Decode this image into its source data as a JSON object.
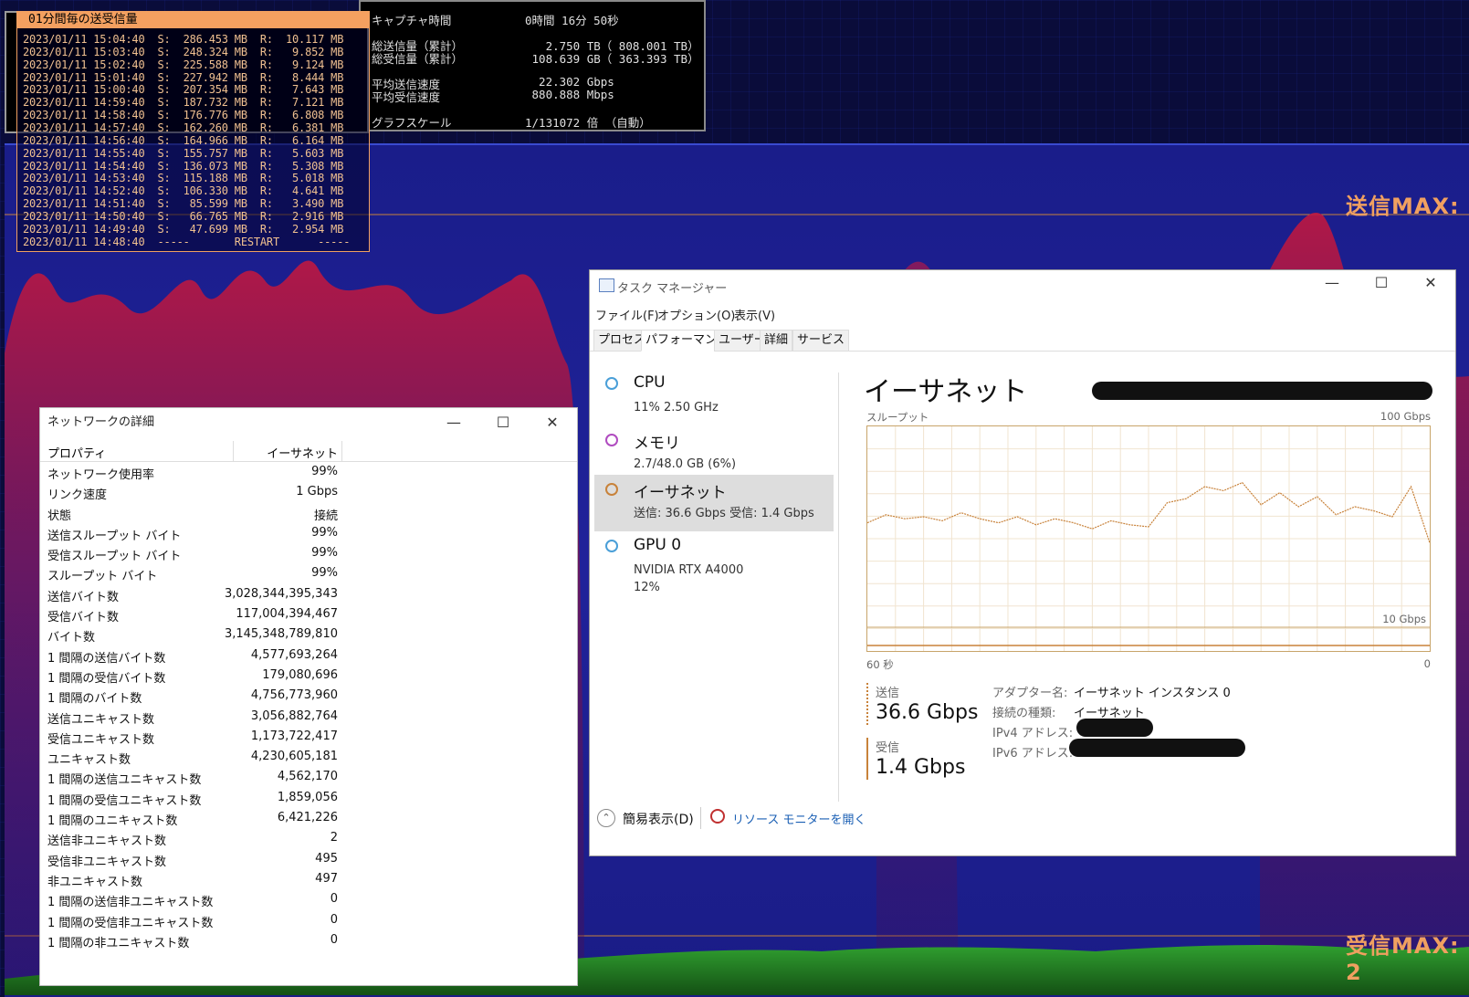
{
  "monitor": {
    "log_header": "01分間毎の送受信量",
    "log_rows": [
      "2023/01/11 15:04:40  S:  286.453 MB  R:  10.117 MB",
      "2023/01/11 15:03:40  S:  248.324 MB  R:   9.852 MB",
      "2023/01/11 15:02:40  S:  225.588 MB  R:   9.124 MB",
      "2023/01/11 15:01:40  S:  227.942 MB  R:   8.444 MB",
      "2023/01/11 15:00:40  S:  207.354 MB  R:   7.643 MB",
      "2023/01/11 14:59:40  S:  187.732 MB  R:   7.121 MB",
      "2023/01/11 14:58:40  S:  176.776 MB  R:   6.808 MB",
      "2023/01/11 14:57:40  S:  162.260 MB  R:   6.381 MB",
      "2023/01/11 14:56:40  S:  164.966 MB  R:   6.164 MB",
      "2023/01/11 14:55:40  S:  155.757 MB  R:   5.603 MB",
      "2023/01/11 14:54:40  S:  136.073 MB  R:   5.308 MB",
      "2023/01/11 14:53:40  S:  115.188 MB  R:   5.018 MB",
      "2023/01/11 14:52:40  S:  106.330 MB  R:   4.641 MB",
      "2023/01/11 14:51:40  S:   85.599 MB  R:   3.490 MB",
      "2023/01/11 14:50:40  S:   66.765 MB  R:   2.916 MB",
      "2023/01/11 14:49:40  S:   47.699 MB  R:   2.954 MB",
      "2023/01/11 14:48:40  -----       RESTART      -----"
    ],
    "summary": [
      {
        "label": "キャプチャ時間",
        "value": "0時間 16分 50秒"
      },
      {
        "label": "総送信量（累計）",
        "value": "   2.750 TB（ 808.001 TB）"
      },
      {
        "label": "総受信量（累計）",
        "value": " 108.639 GB（ 363.393 TB）"
      },
      {
        "label": "平均送信速度",
        "value": "  22.302 Gbps"
      },
      {
        "label": "平均受信速度",
        "value": " 880.888 Mbps"
      },
      {
        "label": "グラフスケール",
        "value": "1/131072 倍 （自動）"
      }
    ],
    "send_max_label": "送信MAX:",
    "recv_max_label": "受信MAX: 2"
  },
  "netdetail": {
    "title": "ネットワークの詳細",
    "col_property": "プロパティ",
    "col_value": "イーサネット",
    "rows": [
      {
        "k": "ネットワーク使用率",
        "v": "99%"
      },
      {
        "k": "リンク速度",
        "v": "1 Gbps"
      },
      {
        "k": "状態",
        "v": "接続"
      },
      {
        "k": "送信スループット バイト",
        "v": "99%"
      },
      {
        "k": "受信スループット バイト",
        "v": "99%"
      },
      {
        "k": "スループット バイト",
        "v": "99%"
      },
      {
        "k": "送信バイト数",
        "v": "3,028,344,395,343"
      },
      {
        "k": "受信バイト数",
        "v": "117,004,394,467"
      },
      {
        "k": "バイト数",
        "v": "3,145,348,789,810"
      },
      {
        "k": "1 間隔の送信バイト数",
        "v": "4,577,693,264"
      },
      {
        "k": "1 間隔の受信バイト数",
        "v": "179,080,696"
      },
      {
        "k": "1 間隔のバイト数",
        "v": "4,756,773,960"
      },
      {
        "k": "送信ユニキャスト数",
        "v": "3,056,882,764"
      },
      {
        "k": "受信ユニキャスト数",
        "v": "1,173,722,417"
      },
      {
        "k": "ユニキャスト数",
        "v": "4,230,605,181"
      },
      {
        "k": "1 間隔の送信ユニキャスト数",
        "v": "4,562,170"
      },
      {
        "k": "1 間隔の受信ユニキャスト数",
        "v": "1,859,056"
      },
      {
        "k": "1 間隔のユニキャスト数",
        "v": "6,421,226"
      },
      {
        "k": "送信非ユニキャスト数",
        "v": "2"
      },
      {
        "k": "受信非ユニキャスト数",
        "v": "495"
      },
      {
        "k": "非ユニキャスト数",
        "v": "497"
      },
      {
        "k": "1 間隔の送信非ユニキャスト数",
        "v": "0"
      },
      {
        "k": "1 間隔の受信非ユニキャスト数",
        "v": "0"
      },
      {
        "k": "1 間隔の非ユニキャスト数",
        "v": "0"
      }
    ]
  },
  "taskmgr": {
    "title": "タスク マネージャー",
    "menu": [
      "ファイル(F)",
      "オプション(O)",
      "表示(V)"
    ],
    "tabs": [
      "プロセス",
      "パフォーマンス",
      "ユーザー",
      "詳細",
      "サービス"
    ],
    "side": [
      {
        "name": "CPU",
        "sub": "11% 2.50 GHz",
        "color": "#4a9fd8"
      },
      {
        "name": "メモリ",
        "sub": "2.7/48.0 GB (6%)",
        "color": "#b04cc0"
      },
      {
        "name": "イーサネット",
        "sub": "送信: 36.6 Gbps 受信: 1.4 Gbps",
        "color": "#c8823a"
      },
      {
        "name": "GPU 0",
        "sub": "NVIDIA RTX A4000",
        "sub2": "12%",
        "color": "#4a9fd8"
      }
    ],
    "main_title": "イーサネット",
    "throughput_label": "スループット",
    "scale_max": "100 Gbps",
    "scale_mid": "10 Gbps",
    "time_left": "60 秒",
    "time_right": "0",
    "send_label": "送信",
    "send_value": "36.6 Gbps",
    "recv_label": "受信",
    "recv_value": "1.4 Gbps",
    "adapter_k": "アダプター名:",
    "adapter_v": "イーサネット インスタンス 0",
    "conn_k": "接続の種類:",
    "conn_v": "イーサネット",
    "ipv4_k": "IPv4 アドレス:",
    "ipv6_k": "IPv6 アドレス:",
    "simple_view": "簡易表示(D)",
    "resmon": "リソース モニターを開く",
    "accent": "#c8823a"
  },
  "chart_data": {
    "type": "line",
    "title": "",
    "xlabel": "",
    "ylabel": "",
    "x": [
      60,
      58,
      56,
      54,
      52,
      50,
      48,
      46,
      44,
      42,
      40,
      38,
      36,
      34,
      32,
      30,
      28,
      26,
      24,
      22,
      20,
      18,
      16,
      14,
      12,
      10,
      8,
      6,
      4,
      2,
      0
    ],
    "series": [
      {
        "name": "送信",
        "values": [
          52,
          56,
          54,
          55,
          53,
          57,
          54,
          52,
          55,
          51,
          54,
          52,
          49,
          53,
          51,
          50,
          62,
          64,
          70,
          68,
          72,
          61,
          67,
          60,
          65,
          56,
          60,
          58,
          55,
          70,
          42
        ]
      },
      {
        "name": "受信",
        "values": [
          2,
          2,
          2,
          2,
          2,
          2,
          2,
          2,
          2,
          2,
          2,
          2,
          2,
          2,
          2,
          2,
          2,
          2,
          2,
          2,
          2,
          2,
          2,
          2,
          2,
          2,
          2,
          2,
          2,
          2,
          2
        ]
      }
    ],
    "ylim": [
      0,
      100
    ]
  }
}
